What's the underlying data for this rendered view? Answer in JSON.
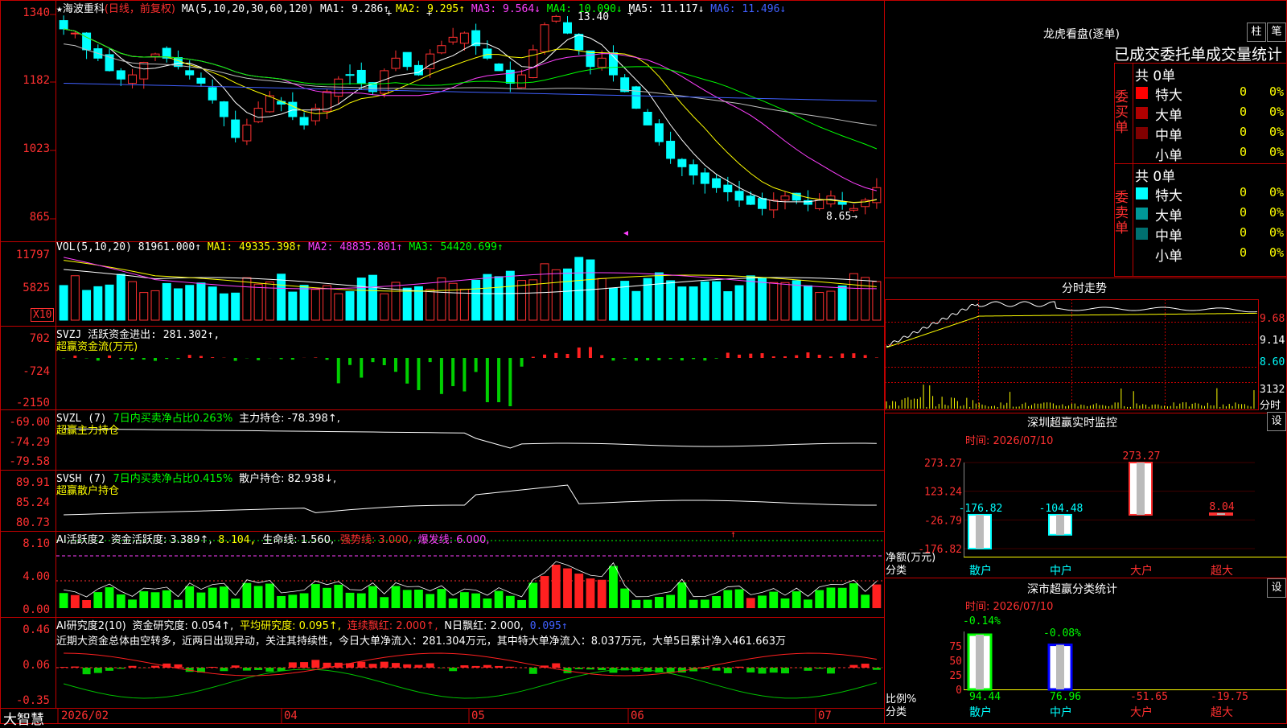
{
  "stock": {
    "name": "海波重科",
    "mode": "(日线，前复权)",
    "ma_label": "MA(5,10,20,30,60,120)",
    "ma1": "MA1: 9.286↑",
    "ma2": "MA2: 9.295↑",
    "ma3": "MA3: 9.564↓",
    "ma4": "MA4: 10.090↓",
    "ma5": "MA5: 11.117↓",
    "ma6": "MA6: 11.496↓",
    "high_mark": "13.40",
    "low_mark": "8.65→",
    "price_ticks": [
      "1340",
      "1182",
      "1023",
      "865"
    ]
  },
  "vol": {
    "label": "VOL(5,10,20)",
    "value": "81961.000↑",
    "ma1": "MA1: 49335.398↑",
    "ma2": "MA2: 48835.801↑",
    "ma3": "MA3: 54420.699↑",
    "ticks": [
      "11797",
      "5825"
    ],
    "unit": "X10"
  },
  "svzj": {
    "label": "SVZJ  活跃资金进出: 281.302↑,",
    "sub": "超赢资金流(万元)",
    "ticks": [
      "702",
      "-724",
      "-2150"
    ]
  },
  "svzl": {
    "label": "SVZL (7)",
    "label2": "7日内买卖净占比0.263%",
    "label3": "主力持仓: -78.398↑,",
    "sub": "超赢主力持仓",
    "ticks": [
      "-69.00",
      "-74.29",
      "-79.58"
    ]
  },
  "svsh": {
    "label": "SVSH (7)",
    "label2": "7日内买卖净占比0.415%",
    "label3": "散户持仓: 82.938↓,",
    "sub": "超赢散户持仓",
    "ticks": [
      "89.91",
      "85.24",
      "80.73"
    ]
  },
  "ai1": {
    "label": "AI活跃度2",
    "v1": "资金活跃度: 3.389↑,",
    "v2": "8.104,",
    "v3": "生命线: 1.560,",
    "v4": "强势线: 3.000,",
    "v5": "爆发线: 6.000,",
    "ticks": [
      "8.10",
      "4.00",
      "0.00"
    ]
  },
  "ai2": {
    "label": "AI研究度2(10)",
    "v1": "资金研究度: 0.054↑,",
    "v2": "平均研究度: 0.095↑,",
    "v3": "连续飘红: 2.000↑,",
    "v4": "N日飘红: 2.000,",
    "v5": "0.095↑",
    "desc": "近期大资金总体由空转多，近两日出现异动，关注其持续性，今日大单净流入：281.304万元，其中特大单净流入：8.037万元，大单5日累计净入461.663万",
    "ticks": [
      "0.46",
      "0.06",
      "-0.35"
    ]
  },
  "xaxis": {
    "brand": "大智慧",
    "labels": [
      "2026/02",
      "04",
      "05",
      "06",
      "07"
    ]
  },
  "longhu": {
    "title": "龙虎看盘(逐单)",
    "btn1": "柱",
    "btn2": "笔",
    "header": "已成交委托单成交量统计",
    "buy_label": "委买单",
    "sell_label": "委卖单",
    "buy_total": "共 0单",
    "sell_total": "共 0单",
    "rows": [
      {
        "name": "特大",
        "count": "0",
        "pct": "0%"
      },
      {
        "name": "大单",
        "count": "0",
        "pct": "0%"
      },
      {
        "name": "中单",
        "count": "0",
        "pct": "0%"
      },
      {
        "name": "小单",
        "count": "0",
        "pct": "0%"
      }
    ],
    "buy_colors": [
      "#ff0000",
      "#b00000",
      "#800000",
      "#000000"
    ],
    "sell_colors": [
      "#00ffff",
      "#009898",
      "#007070",
      "#000000"
    ]
  },
  "fenshi": {
    "title": "分时走势",
    "ticks": [
      "9.68",
      "9.14",
      "8.60"
    ],
    "vol_tick": "3132",
    "vol_label": "分时"
  },
  "sz_monitor": {
    "title": "深圳超赢实时监控",
    "btn": "设",
    "time": "时间: 2026/07/10",
    "yticks": [
      "273.27",
      "123.24",
      "-26.79",
      "-176.82"
    ],
    "ylabel1": "净额(万元)",
    "ylabel2": "分类",
    "bars": [
      {
        "label": "散户",
        "value": -176.82,
        "text": "-176.82"
      },
      {
        "label": "中户",
        "value": -104.48,
        "text": "-104.48"
      },
      {
        "label": "大户",
        "value": 273.27,
        "text": "273.27"
      },
      {
        "label": "超大",
        "value": 8.04,
        "text": "8.04"
      }
    ]
  },
  "sz_stat": {
    "title": "深市超赢分类统计",
    "btn": "设",
    "time": "时间: 2026/07/10",
    "yticks": [
      "75",
      "50",
      "25",
      "0"
    ],
    "ylabel1": "比例%",
    "ylabel2": "分类",
    "top": [
      "-0.14%",
      "-0.08%"
    ],
    "bars": [
      {
        "label": "散户",
        "value": 94.44,
        "text": "94.44"
      },
      {
        "label": "中户",
        "value": 76.96,
        "text": "76.96"
      },
      {
        "label": "大户",
        "value": -51.65,
        "text": "-51.65"
      },
      {
        "label": "超大",
        "value": -19.75,
        "text": "-19.75"
      }
    ]
  },
  "chart_data": {
    "type": "candlestick",
    "title": "海波重科 (日线，前复权)",
    "price_range": [
      8.65,
      13.4
    ],
    "closes": [
      13.1,
      13.0,
      12.6,
      12.4,
      12.1,
      11.9,
      12.0,
      12.3,
      12.5,
      12.4,
      12.2,
      12.0,
      11.8,
      11.4,
      11.0,
      10.5,
      10.8,
      11.2,
      11.5,
      11.3,
      11.0,
      10.8,
      11.2,
      11.6,
      11.9,
      12.0,
      11.8,
      11.6,
      12.1,
      12.4,
      12.2,
      12.0,
      12.5,
      12.7,
      12.9,
      13.0,
      12.7,
      12.4,
      12.1,
      11.8,
      12.0,
      12.6,
      13.2,
      13.4,
      13.0,
      12.6,
      12.2,
      12.4,
      12.0,
      11.6,
      11.2,
      10.8,
      10.4,
      10.0,
      9.8,
      9.6,
      9.4,
      9.3,
      9.2,
      9.0,
      8.9,
      8.8,
      9.0,
      9.1,
      9.0,
      8.9,
      9.0,
      9.1,
      8.9,
      8.8,
      9.0,
      9.3
    ],
    "volume_ticks": [
      "11797",
      "5825"
    ]
  }
}
